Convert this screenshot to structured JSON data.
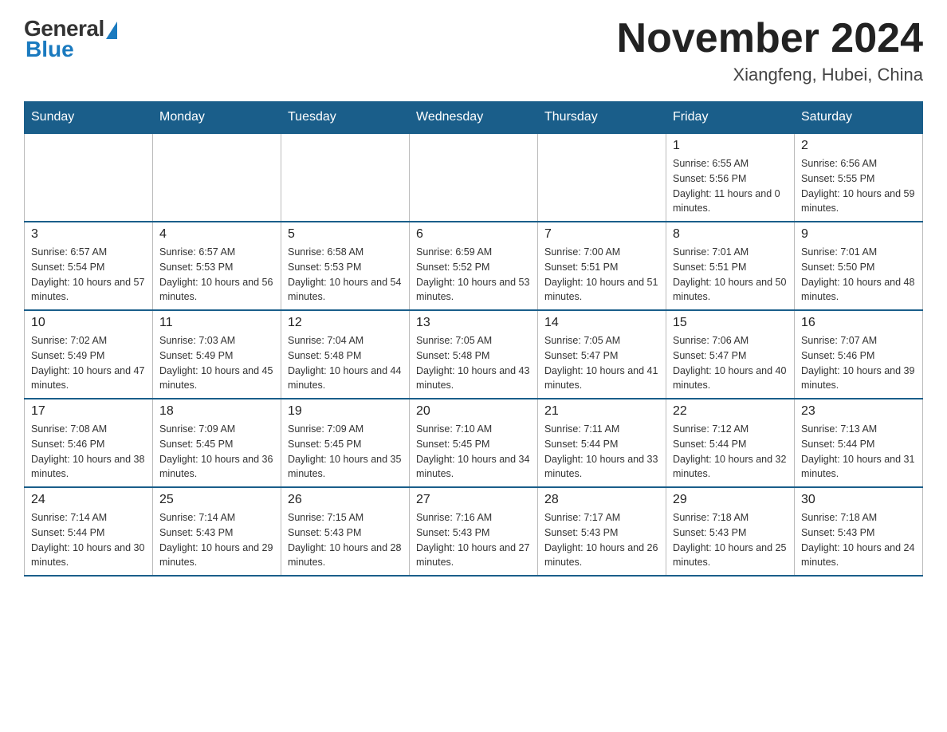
{
  "header": {
    "logo": {
      "general": "General",
      "blue": "Blue"
    },
    "title": "November 2024",
    "location": "Xiangfeng, Hubei, China"
  },
  "weekdays": [
    "Sunday",
    "Monday",
    "Tuesday",
    "Wednesday",
    "Thursday",
    "Friday",
    "Saturday"
  ],
  "weeks": [
    [
      {
        "day": "",
        "info": "",
        "empty": true
      },
      {
        "day": "",
        "info": "",
        "empty": true
      },
      {
        "day": "",
        "info": "",
        "empty": true
      },
      {
        "day": "",
        "info": "",
        "empty": true
      },
      {
        "day": "",
        "info": "",
        "empty": true
      },
      {
        "day": "1",
        "info": "Sunrise: 6:55 AM\nSunset: 5:56 PM\nDaylight: 11 hours and 0 minutes."
      },
      {
        "day": "2",
        "info": "Sunrise: 6:56 AM\nSunset: 5:55 PM\nDaylight: 10 hours and 59 minutes."
      }
    ],
    [
      {
        "day": "3",
        "info": "Sunrise: 6:57 AM\nSunset: 5:54 PM\nDaylight: 10 hours and 57 minutes."
      },
      {
        "day": "4",
        "info": "Sunrise: 6:57 AM\nSunset: 5:53 PM\nDaylight: 10 hours and 56 minutes."
      },
      {
        "day": "5",
        "info": "Sunrise: 6:58 AM\nSunset: 5:53 PM\nDaylight: 10 hours and 54 minutes."
      },
      {
        "day": "6",
        "info": "Sunrise: 6:59 AM\nSunset: 5:52 PM\nDaylight: 10 hours and 53 minutes."
      },
      {
        "day": "7",
        "info": "Sunrise: 7:00 AM\nSunset: 5:51 PM\nDaylight: 10 hours and 51 minutes."
      },
      {
        "day": "8",
        "info": "Sunrise: 7:01 AM\nSunset: 5:51 PM\nDaylight: 10 hours and 50 minutes."
      },
      {
        "day": "9",
        "info": "Sunrise: 7:01 AM\nSunset: 5:50 PM\nDaylight: 10 hours and 48 minutes."
      }
    ],
    [
      {
        "day": "10",
        "info": "Sunrise: 7:02 AM\nSunset: 5:49 PM\nDaylight: 10 hours and 47 minutes."
      },
      {
        "day": "11",
        "info": "Sunrise: 7:03 AM\nSunset: 5:49 PM\nDaylight: 10 hours and 45 minutes."
      },
      {
        "day": "12",
        "info": "Sunrise: 7:04 AM\nSunset: 5:48 PM\nDaylight: 10 hours and 44 minutes."
      },
      {
        "day": "13",
        "info": "Sunrise: 7:05 AM\nSunset: 5:48 PM\nDaylight: 10 hours and 43 minutes."
      },
      {
        "day": "14",
        "info": "Sunrise: 7:05 AM\nSunset: 5:47 PM\nDaylight: 10 hours and 41 minutes."
      },
      {
        "day": "15",
        "info": "Sunrise: 7:06 AM\nSunset: 5:47 PM\nDaylight: 10 hours and 40 minutes."
      },
      {
        "day": "16",
        "info": "Sunrise: 7:07 AM\nSunset: 5:46 PM\nDaylight: 10 hours and 39 minutes."
      }
    ],
    [
      {
        "day": "17",
        "info": "Sunrise: 7:08 AM\nSunset: 5:46 PM\nDaylight: 10 hours and 38 minutes."
      },
      {
        "day": "18",
        "info": "Sunrise: 7:09 AM\nSunset: 5:45 PM\nDaylight: 10 hours and 36 minutes."
      },
      {
        "day": "19",
        "info": "Sunrise: 7:09 AM\nSunset: 5:45 PM\nDaylight: 10 hours and 35 minutes."
      },
      {
        "day": "20",
        "info": "Sunrise: 7:10 AM\nSunset: 5:45 PM\nDaylight: 10 hours and 34 minutes."
      },
      {
        "day": "21",
        "info": "Sunrise: 7:11 AM\nSunset: 5:44 PM\nDaylight: 10 hours and 33 minutes."
      },
      {
        "day": "22",
        "info": "Sunrise: 7:12 AM\nSunset: 5:44 PM\nDaylight: 10 hours and 32 minutes."
      },
      {
        "day": "23",
        "info": "Sunrise: 7:13 AM\nSunset: 5:44 PM\nDaylight: 10 hours and 31 minutes."
      }
    ],
    [
      {
        "day": "24",
        "info": "Sunrise: 7:14 AM\nSunset: 5:44 PM\nDaylight: 10 hours and 30 minutes."
      },
      {
        "day": "25",
        "info": "Sunrise: 7:14 AM\nSunset: 5:43 PM\nDaylight: 10 hours and 29 minutes."
      },
      {
        "day": "26",
        "info": "Sunrise: 7:15 AM\nSunset: 5:43 PM\nDaylight: 10 hours and 28 minutes."
      },
      {
        "day": "27",
        "info": "Sunrise: 7:16 AM\nSunset: 5:43 PM\nDaylight: 10 hours and 27 minutes."
      },
      {
        "day": "28",
        "info": "Sunrise: 7:17 AM\nSunset: 5:43 PM\nDaylight: 10 hours and 26 minutes."
      },
      {
        "day": "29",
        "info": "Sunrise: 7:18 AM\nSunset: 5:43 PM\nDaylight: 10 hours and 25 minutes."
      },
      {
        "day": "30",
        "info": "Sunrise: 7:18 AM\nSunset: 5:43 PM\nDaylight: 10 hours and 24 minutes."
      }
    ]
  ]
}
